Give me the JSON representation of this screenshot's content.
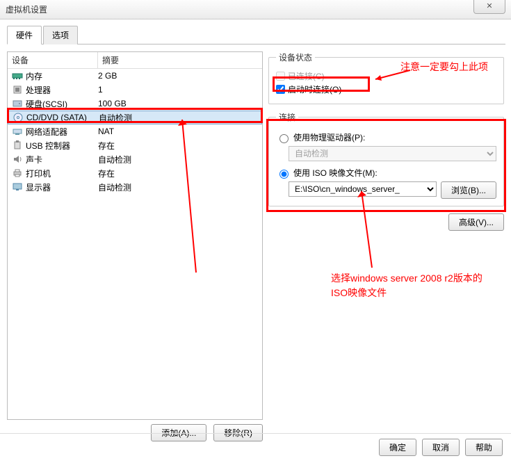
{
  "window": {
    "title": "虚拟机设置",
    "close_glyph": "✕"
  },
  "tabs": {
    "hardware": "硬件",
    "options": "选项"
  },
  "list": {
    "head_device": "设备",
    "head_summary": "摘要",
    "rows": [
      {
        "label": "内存",
        "summary": "2 GB"
      },
      {
        "label": "处理器",
        "summary": "1"
      },
      {
        "label": "硬盘(SCSI)",
        "summary": "100 GB"
      },
      {
        "label": "CD/DVD (SATA)",
        "summary": "自动检测"
      },
      {
        "label": "网络适配器",
        "summary": "NAT"
      },
      {
        "label": "USB 控制器",
        "summary": "存在"
      },
      {
        "label": "声卡",
        "summary": "自动检测"
      },
      {
        "label": "打印机",
        "summary": "存在"
      },
      {
        "label": "显示器",
        "summary": "自动检测"
      }
    ]
  },
  "left_buttons": {
    "add": "添加(A)...",
    "remove": "移除(R)"
  },
  "device_status": {
    "legend": "设备状态",
    "connected": "已连接(C)",
    "connect_at_power_on": "启动时连接(O)"
  },
  "connection": {
    "legend": "连接",
    "use_physical": "使用物理驱动器(P):",
    "physical_value": "自动检测",
    "use_iso": "使用 ISO 映像文件(M):",
    "iso_value": "E:\\ISO\\cn_windows_server_",
    "browse": "浏览(B)..."
  },
  "advanced": "高级(V)...",
  "bottom": {
    "ok": "确定",
    "cancel": "取消",
    "help": "帮助"
  },
  "annot": {
    "top": "注意一定要勾上此项",
    "mid": "选择windows server 2008 r2版本的ISO映像文件"
  }
}
